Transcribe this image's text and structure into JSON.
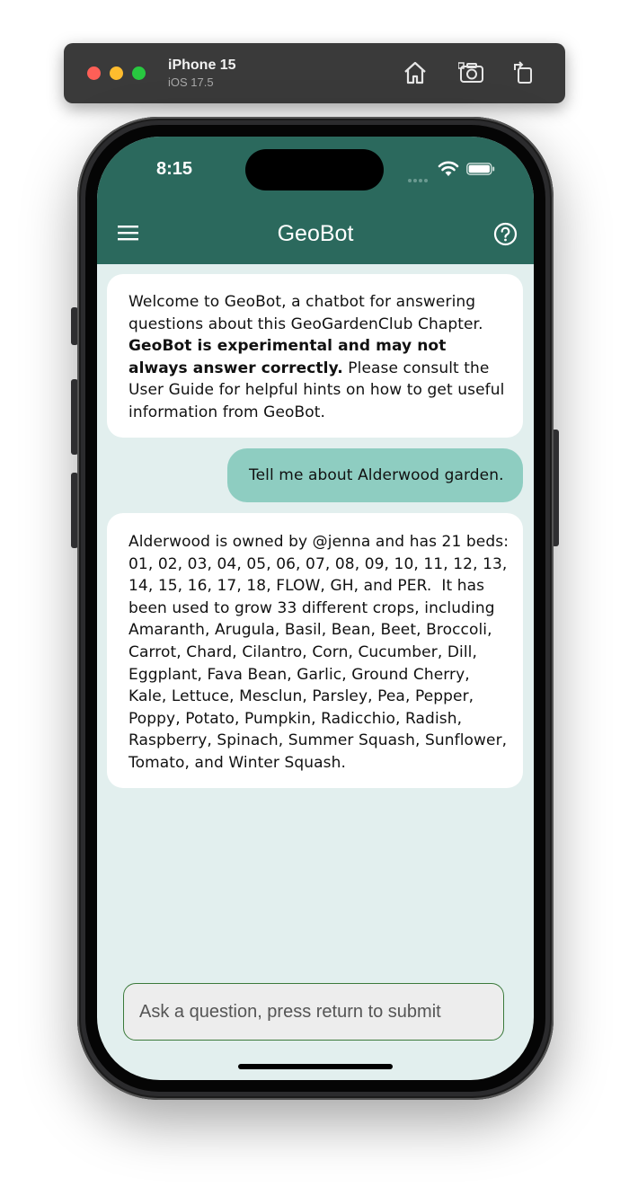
{
  "simulator": {
    "device": "iPhone 15",
    "os": "iOS 17.5",
    "icons": [
      "home-icon",
      "screenshot-icon",
      "rotate-icon"
    ]
  },
  "status_bar": {
    "time": "8:15"
  },
  "app": {
    "title": "GeoBot",
    "header_color": "#2b695d",
    "background_color": "#e2efee"
  },
  "messages": [
    {
      "role": "bot",
      "text_before": "Welcome to GeoBot, a chatbot for answering questions about this GeoGardenClub Chapter. ",
      "bold": "GeoBot is experimental and may not always answer correctly.",
      "text_after": " Please consult the User Guide for helpful hints on how to get useful information from GeoBot."
    },
    {
      "role": "user",
      "text": "Tell me about Alderwood garden."
    },
    {
      "role": "bot",
      "text": "Alderwood is owned by @jenna and has 21 beds: 01, 02, 03, 04, 05, 06, 07, 08, 09, 10, 11, 12, 13, 14, 15, 16, 17, 18, FLOW, GH, and PER.  It has been used to grow 33 different crops, including Amaranth, Arugula, Basil, Bean, Beet, Broccoli, Carrot, Chard, Cilantro, Corn, Cucumber, Dill, Eggplant, Fava Bean, Garlic, Ground Cherry, Kale, Lettuce, Mesclun, Parsley, Pea, Pepper, Poppy, Potato, Pumpkin, Radicchio, Radish, Raspberry, Spinach, Summer Squash, Sunflower, Tomato, and Winter Squash."
    }
  ],
  "input": {
    "placeholder": "Ask a question, press return to submit",
    "value": ""
  },
  "colors": {
    "user_bubble": "#8ecdc1",
    "bot_bubble": "#ffffff",
    "input_border": "#3b7a3b"
  }
}
